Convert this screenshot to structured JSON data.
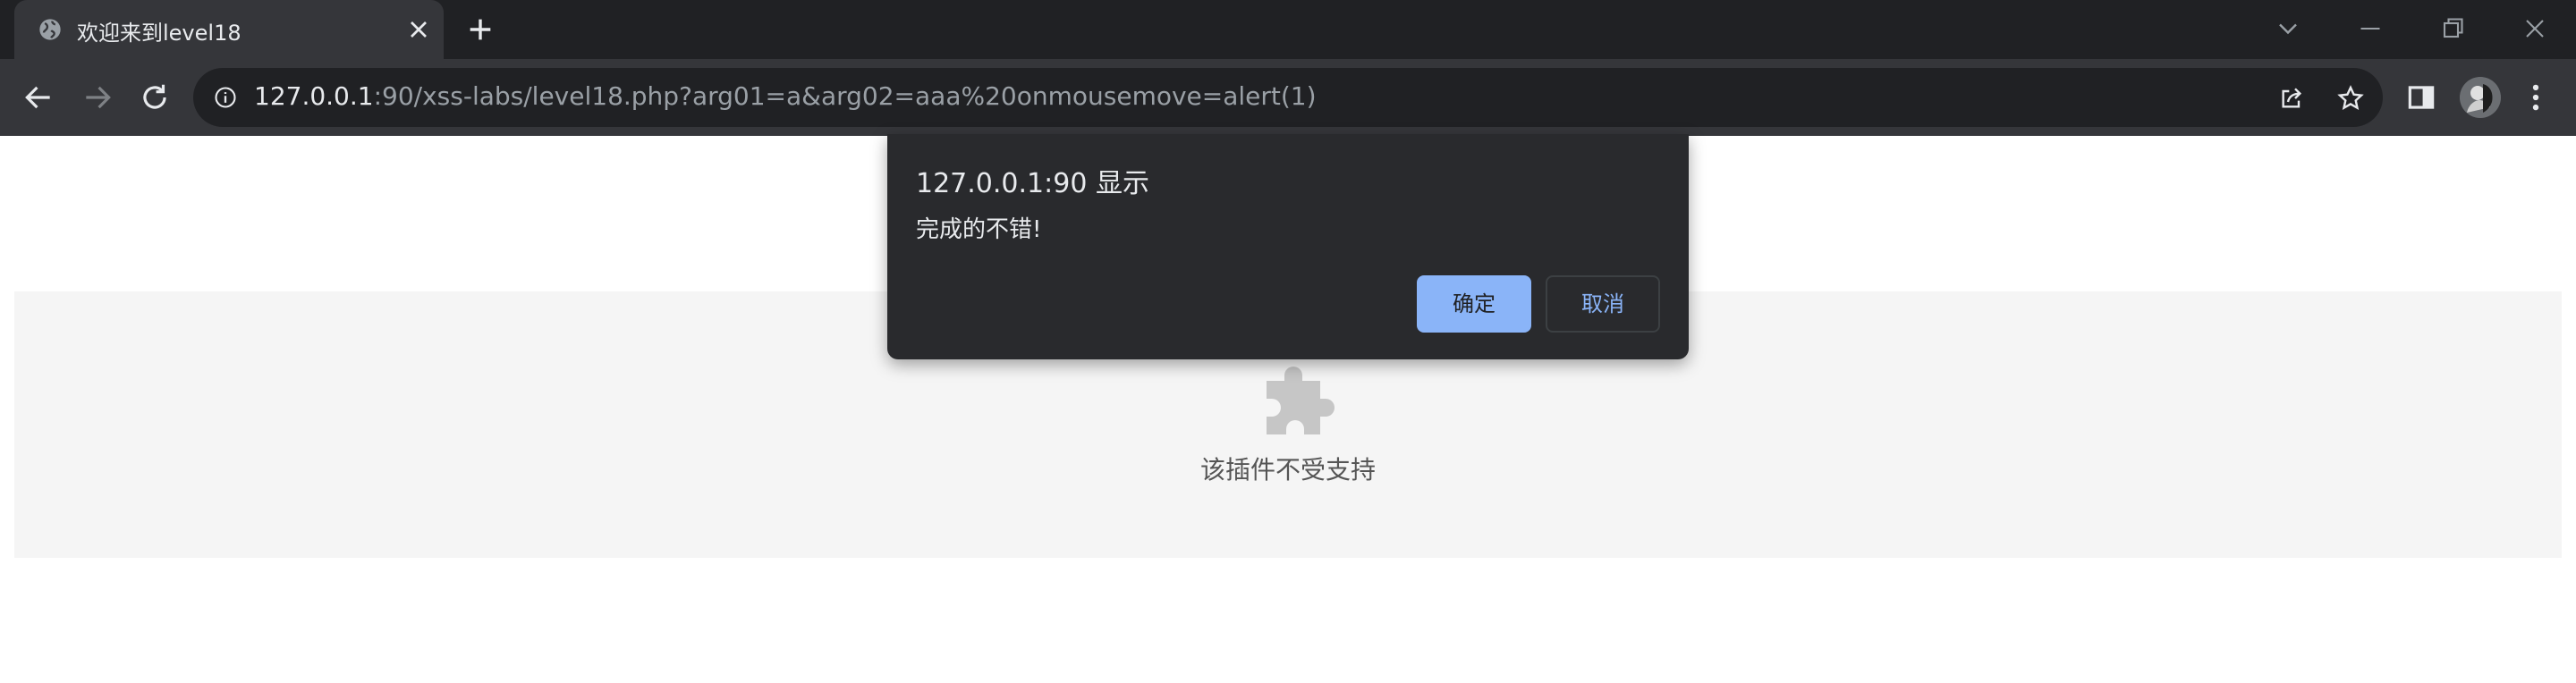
{
  "browser": {
    "tab": {
      "title": "欢迎来到level18",
      "favicon": "globe-icon",
      "close": "close-icon"
    },
    "new_tab": "plus-icon",
    "window_controls": [
      "chevron-down-icon",
      "minimize-icon",
      "restore-icon",
      "close-icon"
    ],
    "nav": [
      "back-icon",
      "forward-icon",
      "reload-icon"
    ],
    "omnibox": {
      "host": "127.0.0.1",
      "rest": ":90/xss-labs/level18.php?arg01=a&arg02=aaa%20onmousemove=alert(1)",
      "left_icon": "info-icon",
      "right_icons": [
        "share-icon",
        "star-icon"
      ]
    },
    "toolbar_right": [
      "side-panel-icon",
      "avatar",
      "kebab-menu-icon"
    ]
  },
  "dialog": {
    "title": "127.0.0.1:90 显示",
    "message": "完成的不错!",
    "ok_label": "确定",
    "cancel_label": "取消"
  },
  "page": {
    "plugin_message": "该插件不受支持",
    "plugin_icon": "puzzle-icon"
  },
  "colors": {
    "tab_strip": "#202124",
    "toolbar": "#35363a",
    "dialog": "#292a2d",
    "accent": "#8ab4f8",
    "plugin_bg": "#f5f5f5"
  }
}
